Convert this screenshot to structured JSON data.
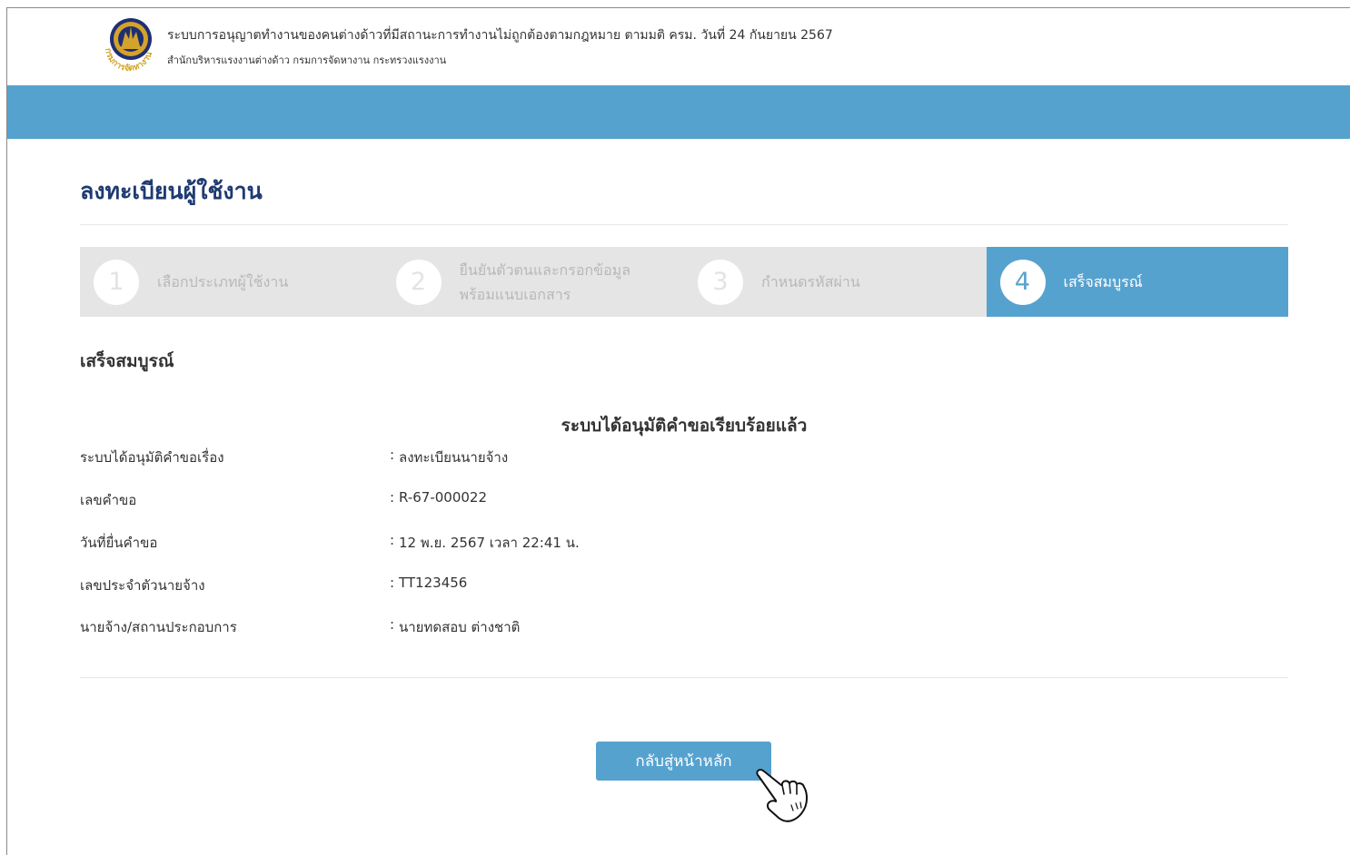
{
  "header": {
    "title": "ระบบการอนุญาตทำงานของคนต่างด้าวที่มีสถานะการทำงานไม่ถูกต้องตามกฎหมาย ตามมติ ครม. วันที่ 24 กันยายน 2567",
    "subtitle": "สำนักบริหารแรงงานต่างด้าว  กรมการจัดหางาน  กระทรวงแรงงาน",
    "logo_text": "กรมการจัดหางาน"
  },
  "page": {
    "title": "ลงทะเบียนผู้ใช้งาน"
  },
  "stepper": {
    "steps": [
      {
        "number": "1",
        "label": "เลือกประเภทผู้ใช้งาน",
        "active": false
      },
      {
        "number": "2",
        "label": "ยืนยันตัวตนและกรอกข้อมูลพร้อมแนบเอกสาร",
        "active": false
      },
      {
        "number": "3",
        "label": "กำหนดรหัสผ่าน",
        "active": false
      },
      {
        "number": "4",
        "label": "เสร็จสมบูรณ์",
        "active": true
      }
    ]
  },
  "result": {
    "section_heading": "เสร็จสมบูรณ์",
    "heading": "ระบบได้อนุมัติคำขอเรียบร้อยแล้ว",
    "separator": ":",
    "rows": [
      {
        "label": "ระบบได้อนุมัติคำขอเรื่อง",
        "value": "ลงทะเบียนนายจ้าง"
      },
      {
        "label": "เลขคำขอ",
        "value": "R-67-000022"
      },
      {
        "label": "วันที่ยื่นคำขอ",
        "value": "12 พ.ย. 2567 เวลา 22:41 น."
      },
      {
        "label": "เลขประจำตัวนายจ้าง",
        "value": "TT123456"
      },
      {
        "label": "นายจ้าง/สถานประกอบการ",
        "value": "นายทดสอบ ต่างชาติ"
      }
    ]
  },
  "actions": {
    "home_label": "กลับสู่หน้าหลัก"
  },
  "colors": {
    "accent": "#56a2cf",
    "title_navy": "#1e3a72",
    "logo_gold": "#d4a32a",
    "logo_blue": "#1f2f73",
    "step_bg": "#e5e5e5"
  },
  "icons": {
    "logo": "department-seal-icon",
    "cursor": "hand-pointer-icon"
  }
}
